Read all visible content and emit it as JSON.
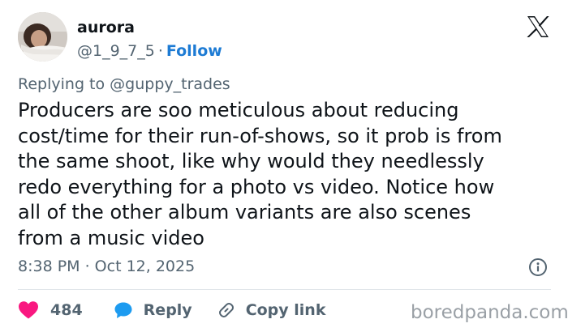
{
  "author": {
    "display_name": "aurora",
    "handle": "@1_9_7_5",
    "separator": "·",
    "follow_label": "Follow"
  },
  "reply_context": "Replying to @guppy_trades",
  "tweet": {
    "lines": [
      "Producers are soo meticulous about reducing",
      "cost/time for their run-of-shows, so it prob is from",
      "the same shoot, like why would they needlessly",
      "redo everything for a photo vs video. Notice how",
      "all of the other album variants are also scenes",
      "from a music video"
    ],
    "timestamp": "8:38 PM · Oct 12, 2025"
  },
  "actions": {
    "like_count": "484",
    "reply_label": "Reply",
    "copy_link_label": "Copy link"
  },
  "watermark": "boredpanda.com",
  "icons": {
    "brand": "x-logo-icon",
    "like": "heart-icon",
    "reply": "speech-bubble-icon",
    "copy": "link-icon",
    "info": "info-icon"
  },
  "colors": {
    "accent": "#1d7bd4",
    "like": "#f91880",
    "text": "#0f1419",
    "muted": "#536471",
    "watermark": "#9aa0a6"
  }
}
